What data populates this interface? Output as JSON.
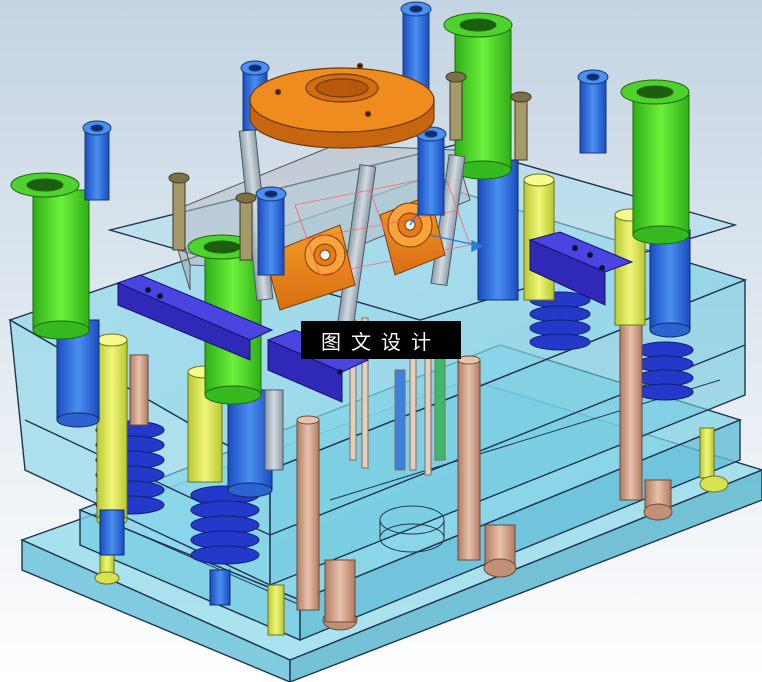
{
  "caption": "图文设计",
  "colors": {
    "background_top": "#c4d4e2",
    "background_bottom": "#ffffff",
    "plate_fill": "#7fd6ea",
    "plate_edge": "#1f3550",
    "guide_pillar": "#2f6fd6",
    "guide_bushing": "#47dd2c",
    "spring": "#2438c9",
    "return_pin": "#d7e85a",
    "ejector_pin": "#c9a08a",
    "top_clamp": "#ef8a1d",
    "slider_block": "#3730cf",
    "cavity_insert": "#f0a43a",
    "screw": "#2f85e0",
    "hand_part": "#a69a6a"
  },
  "icons": [
    "mold-assembly-render"
  ]
}
